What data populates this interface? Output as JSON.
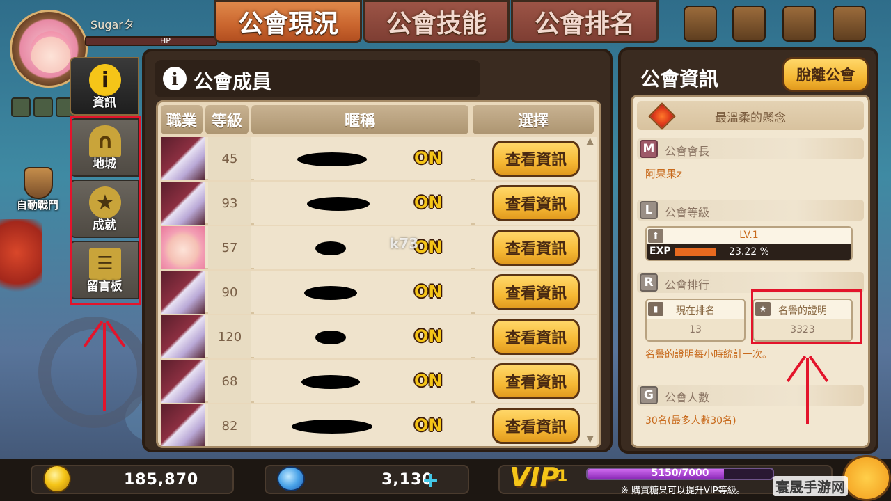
{
  "player": {
    "name": "Sugarタ",
    "hp_label": "HP"
  },
  "auto_battle_label": "自動戰鬥",
  "top_tabs": [
    {
      "label": "公會現況",
      "active": true
    },
    {
      "label": "公會技能",
      "active": false
    },
    {
      "label": "公會排名",
      "active": false
    }
  ],
  "side_tabs": [
    {
      "label": "資訊",
      "icon": "info-icon",
      "active": true
    },
    {
      "label": "地城",
      "icon": "dungeon-gate-icon",
      "active": false
    },
    {
      "label": "成就",
      "icon": "star-medal-icon",
      "active": false
    },
    {
      "label": "留言板",
      "icon": "clipboard-icon",
      "active": false
    }
  ],
  "members_panel": {
    "title": "公會成員",
    "columns": {
      "job": "職業",
      "level": "等級",
      "nickname": "暱稱",
      "select": "選擇"
    },
    "view_button_label": "查看資訊",
    "rows": [
      {
        "level": "45",
        "status": "ON",
        "portrait": "dark"
      },
      {
        "level": "93",
        "status": "ON",
        "portrait": "dark"
      },
      {
        "level": "57",
        "status": "ON",
        "portrait": "pink"
      },
      {
        "level": "90",
        "status": "ON",
        "portrait": "dark"
      },
      {
        "level": "120",
        "status": "ON",
        "portrait": "dark"
      },
      {
        "level": "68",
        "status": "ON",
        "portrait": "dark"
      },
      {
        "level": "82",
        "status": "ON",
        "portrait": "dark"
      }
    ]
  },
  "watermark": "k73",
  "guild_info": {
    "title": "公會資訊",
    "leave_button": "脫離公會",
    "guild_name": "最溫柔的懸念",
    "leader_badge": "M",
    "leader_label": "公會會長",
    "leader_name": "阿果果z",
    "level_badge": "L",
    "level_label": "公會等級",
    "level_value": "LV.1",
    "exp_label": "EXP",
    "exp_percent_text": "23.22 %",
    "exp_fraction": 0.2322,
    "ranking_badge": "R",
    "ranking_label": "公會排行",
    "current_rank_label": "現在排名",
    "current_rank_value": "13",
    "reputation_label": "名譽的證明",
    "reputation_value": "3323",
    "reputation_note": "名譽的證明每小時統計一次。",
    "members_badge": "G",
    "members_label": "公會人數",
    "members_value": "30名(最多人數30名)"
  },
  "bottom": {
    "gold": "185,870",
    "candy": "3,130",
    "vip_label": "VIP",
    "vip_level": "1",
    "vip_progress_text": "5150/7000",
    "vip_progress_fraction": 0.7357,
    "vip_note": "※ 購買糖果可以提升VIP等級。",
    "site_mark": "寰晟手游网"
  },
  "colors": {
    "highlight_red": "#e3142b",
    "accent_orange": "#c86a1c",
    "button_gold": "#f6b935"
  }
}
